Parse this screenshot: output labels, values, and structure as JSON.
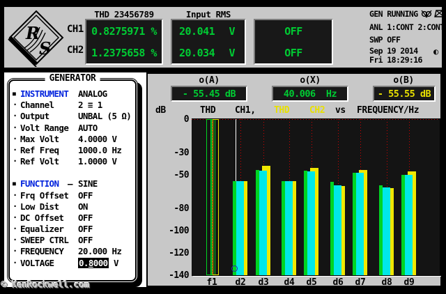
{
  "colors": {
    "panel_gray": "#c8c8c8",
    "display_black": "#181818",
    "lcd_green": "#00cc33",
    "lcd_yellow": "#e8e000",
    "bar_cyan": "#00e8e8",
    "bar_yellow": "#f0e800",
    "bar_green": "#00d422",
    "accent_blue": "#0022dd",
    "grid_red": "#d40000"
  },
  "logo": {
    "letter_r": "R",
    "letter_s": "S"
  },
  "header": {
    "thd": {
      "title": "THD 23456789",
      "rows": [
        {
          "ch": "CH1",
          "value": "0.8275971 %"
        },
        {
          "ch": "CH2",
          "value": "1.2375658 %"
        }
      ]
    },
    "input_rms": {
      "title": "Input RMS",
      "rows": [
        {
          "value": "20.041",
          "unit": "V"
        },
        {
          "value": "20.034",
          "unit": "V"
        }
      ]
    },
    "aux": {
      "rows": [
        "OFF",
        "OFF"
      ]
    },
    "status": {
      "gen": "GEN RUNNING",
      "anl": "ANL 1:CONT 2:CONT",
      "swp": "SWP OFF",
      "date": "Sep 19 2014",
      "time": "Fri 18:29:16",
      "monitor_icon": "speaker-muted-icon",
      "keyboard_icon": "keyboard-off-icon",
      "contrast_glyph": "◐"
    }
  },
  "generator": {
    "title": "GENERATOR",
    "items": [
      {
        "bullet": "■",
        "label": "INSTRUMENT",
        "value": "ANALOG",
        "accent": true
      },
      {
        "bullet": "·",
        "label": "Channel",
        "value": "2 ≡ 1"
      },
      {
        "bullet": "·",
        "label": "Output",
        "value": "UNBAL (5 Ω)"
      },
      {
        "bullet": "·",
        "label": "Volt Range",
        "value": "AUTO"
      },
      {
        "bullet": "·",
        "label": "Max Volt",
        "value": "4.0000 V"
      },
      {
        "bullet": "·",
        "label": "Ref Freq",
        "value": "1000.0 Hz"
      },
      {
        "bullet": "·",
        "label": "Ref Volt",
        "value": "1.0000 V"
      },
      {
        "spacer": true
      },
      {
        "bullet": "■",
        "label": "FUNCTION",
        "dash": "—",
        "value": "SINE",
        "accent": true
      },
      {
        "bullet": "·",
        "label": "Frq Offset",
        "value": "OFF"
      },
      {
        "bullet": "·",
        "label": "Low Dist",
        "value": "ON"
      },
      {
        "bullet": "·",
        "label": "DC Offset",
        "value": "OFF"
      },
      {
        "bullet": "·",
        "label": "Equalizer",
        "value": "OFF"
      },
      {
        "bullet": "·",
        "label": "SWEEP CTRL",
        "value": "OFF"
      },
      {
        "bullet": "·",
        "label": "FREQUENCY",
        "value": "20.000 Hz"
      },
      {
        "bullet": "·",
        "label": "VOLTAGE",
        "highlight": {
          "pre": "0.",
          "cursor": "8",
          "post": "000"
        },
        "unit": "V"
      }
    ]
  },
  "graph": {
    "cursor_a_label": "o(A)",
    "cursor_x_label": "o(X)",
    "cursor_b_label": "o(B)",
    "cursor_a_value": "- 55.45 dB",
    "cursor_x_value": "40.006  Hz",
    "cursor_b_value": "- 55.55 dB",
    "axis_unit": "dB",
    "trace1_func": "THD",
    "trace1_ch": "CH1,",
    "trace2_func": "THD",
    "trace2_ch": "CH2",
    "vs": "vs",
    "x_axis_label": "FREQUENCY/Hz"
  },
  "chart_data": {
    "type": "bar",
    "title": "THD CH1, THD CH2 vs FREQUENCY/Hz",
    "xlabel": "FREQUENCY/Hz",
    "ylabel": "dB",
    "ylim": [
      -140,
      0
    ],
    "grid": true,
    "grid_step_db": 10,
    "ytick_values": [
      0,
      -30,
      -50,
      -80,
      -100,
      -120,
      -140
    ],
    "ytick_labels": [
      "0",
      "-30",
      "-50",
      "-80",
      "-100",
      "-120",
      "-140"
    ],
    "categories": [
      "f1",
      "d2",
      "d3",
      "d4",
      "d5",
      "d6",
      "d7",
      "d8",
      "d9"
    ],
    "series": [
      {
        "name": "THD CH1 bar (cyan)",
        "color": "#00e8e8",
        "values": [
          0,
          -55.5,
          -46,
          -55.5,
          -47,
          -59.5,
          -48,
          -61,
          -50
        ]
      },
      {
        "name": "THD CH2 bar (yellow)",
        "color": "#f0e800",
        "values": [
          0,
          -55.5,
          -42,
          -55.5,
          -43.5,
          -60,
          -45.5,
          -62,
          -47
        ]
      },
      {
        "name": "CH1 marker bar (green)",
        "color": "#00d422",
        "values": [
          0,
          -55.5,
          -45.5,
          -55.5,
          -46.5,
          -56.5,
          -48,
          -59.5,
          -50
        ]
      }
    ],
    "fundamental_hollow": true,
    "cursor_line": {
      "category": "d2",
      "db": -55.45
    },
    "circle_marker": {
      "category": "d2",
      "db": -134
    }
  },
  "watermark": "© KenRockwell.com"
}
